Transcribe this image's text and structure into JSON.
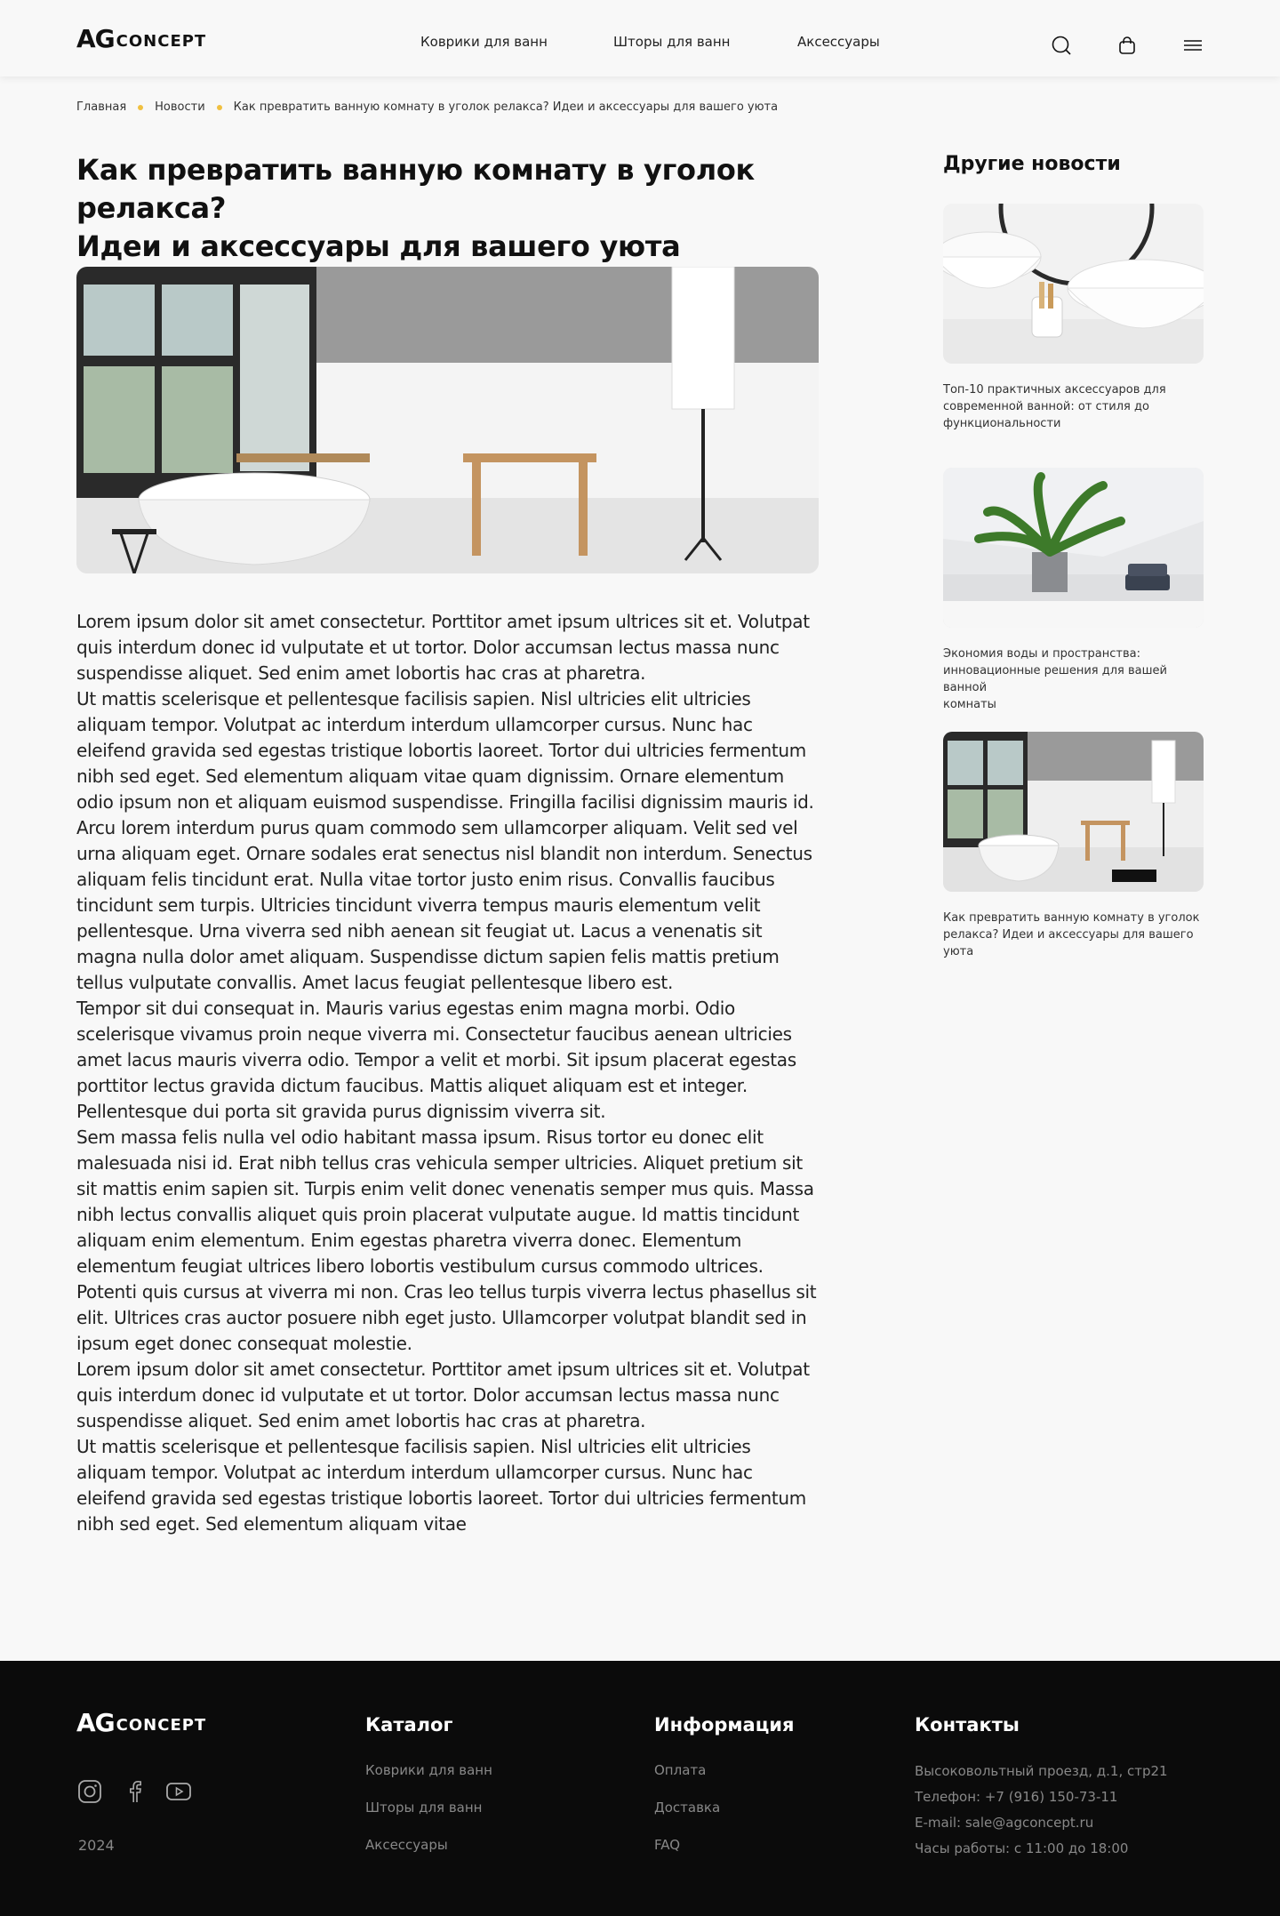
{
  "header": {
    "logo_ag": "AG",
    "logo_concept": "CONCEPT",
    "nav": [
      "Коврики для ванн",
      "Шторы для ванн",
      "Аксессуары"
    ],
    "icons": [
      "search-icon",
      "bag-icon",
      "menu-icon"
    ]
  },
  "breadcrumb": [
    "Главная",
    "Новости",
    "Как превратить ванную комнату в уголок релакса? Идеи и аксессуары для вашего уюта"
  ],
  "article": {
    "title_line1": "Как превратить ванную комнату в уголок релакса?",
    "title_line2": "Идеи и аксессуары для вашего уюта",
    "paragraphs": [
      "Lorem ipsum dolor sit amet consectetur. Porttitor amet ipsum ultrices sit et. Volutpat quis interdum donec id vulputate et ut tortor. Dolor accumsan lectus massa nunc suspendisse aliquet. Sed enim amet lobortis hac cras at pharetra.",
      "Ut mattis scelerisque et pellentesque facilisis sapien. Nisl ultricies elit ultricies aliquam tempor. Volutpat ac interdum interdum ullamcorper cursus. Nunc hac eleifend gravida sed egestas tristique lobortis laoreet. Tortor dui ultricies fermentum nibh sed eget. Sed elementum aliquam vitae quam dignissim. Ornare elementum odio ipsum non et aliquam euismod suspendisse. Fringilla facilisi dignissim mauris id. Arcu lorem interdum purus quam commodo sem ullamcorper aliquam. Velit sed vel urna aliquam eget. Ornare sodales erat senectus nisl blandit non interdum. Senectus aliquam felis tincidunt erat. Nulla vitae tortor justo enim risus. Convallis faucibus tincidunt sem turpis. Ultricies tincidunt viverra tempus mauris elementum velit pellentesque. Urna viverra sed nibh aenean sit feugiat ut. Lacus a venenatis sit magna nulla dolor amet aliquam. Suspendisse dictum sapien felis mattis pretium tellus vulputate convallis. Amet lacus feugiat pellentesque libero est.",
      "Tempor sit dui consequat in. Mauris varius egestas enim magna morbi. Odio scelerisque vivamus proin neque viverra mi. Consectetur faucibus aenean ultricies amet lacus mauris viverra odio. Tempor a velit et morbi. Sit ipsum placerat egestas porttitor lectus gravida dictum faucibus. Mattis aliquet aliquam est et integer. Pellentesque dui porta sit gravida purus dignissim viverra sit.",
      "Sem massa felis nulla vel odio habitant massa ipsum. Risus tortor eu donec elit malesuada nisi id. Erat nibh tellus cras vehicula semper ultricies. Aliquet pretium sit sit mattis enim sapien sit. Turpis enim velit donec venenatis semper mus quis. Massa nibh lectus convallis aliquet quis proin placerat vulputate augue. Id mattis tincidunt aliquam enim elementum. Enim egestas pharetra viverra donec. Elementum elementum feugiat ultrices libero lobortis vestibulum cursus commodo ultrices. Potenti quis cursus at viverra mi non. Cras leo tellus turpis viverra lectus phasellus sit elit. Ultrices cras auctor posuere nibh eget justo. Ullamcorper volutpat blandit sed in ipsum eget donec consequat molestie.",
      "Lorem ipsum dolor sit amet consectetur. Porttitor amet ipsum ultrices sit et. Volutpat quis interdum donec id vulputate et ut tortor. Dolor accumsan lectus massa nunc suspendisse aliquet. Sed enim amet lobortis hac cras at pharetra.",
      "Ut mattis scelerisque et pellentesque facilisis sapien. Nisl ultricies elit ultricies aliquam tempor. Volutpat ac interdum interdum ullamcorper cursus. Nunc hac eleifend gravida sed egestas tristique lobortis laoreet. Tortor dui ultricies fermentum nibh sed eget. Sed elementum aliquam vitae"
    ]
  },
  "sidebar": {
    "title": "Другие новости",
    "cards": [
      {
        "line1": "Топ-10 практичных аксессуаров для",
        "line2": "современной ванной: от стиля до",
        "line3": "функциональности"
      },
      {
        "line1": "Экономия воды и пространства:",
        "line2": "инновационные решения для вашей ванной",
        "line3": "комнаты"
      },
      {
        "line1": "Как превратить ванную комнату в уголок",
        "line2": "релакса? Идеи и аксессуары для вашего",
        "line3": "уюта"
      }
    ]
  },
  "footer": {
    "logo_ag": "AG",
    "logo_concept": "CONCEPT",
    "year": "2024",
    "social_icons": [
      "instagram-icon",
      "facebook-icon",
      "youtube-icon"
    ],
    "catalog": {
      "title": "Каталог",
      "links": [
        "Коврики для ванн",
        "Шторы для ванн",
        "Аксессуары"
      ]
    },
    "info": {
      "title": "Информация",
      "links": [
        "Оплата",
        "Доставка",
        "FAQ"
      ]
    },
    "contacts": {
      "title": "Контакты",
      "address": "Высоковольтный проезд, д.1,  стр21",
      "phone": "Телефон: +7 (916) 150-73-11",
      "email": "E-mail: sale@agconcept.ru",
      "hours": "Часы работы:  с 11:00 до 18:00"
    }
  },
  "colors": {
    "accent_dot": "#f0c040",
    "footer_bg": "#0b0b0b",
    "page_bg": "#f8f8f8"
  }
}
